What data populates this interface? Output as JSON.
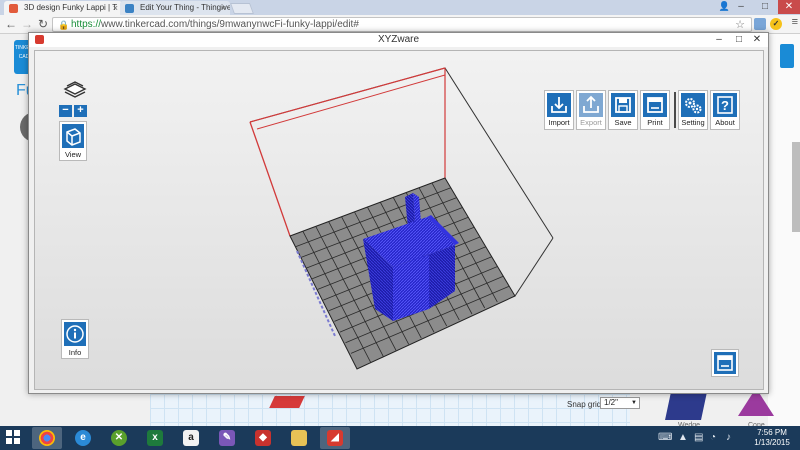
{
  "browser": {
    "tabs": [
      {
        "title": "3D design Funky Lappi | T",
        "active": true,
        "favicon_color": "#e25b3b"
      },
      {
        "title": "Edit Your Thing - Thingive",
        "active": false,
        "favicon_color": "#3b82c4"
      }
    ],
    "url_scheme": "https://",
    "url_rest": "www.tinkercad.com/things/9mwanynwcFi-funky-lappi/edit#"
  },
  "tinkercad": {
    "logo_letters": "TINKERCAD",
    "title": "Fu",
    "snap_grid_label": "Snap grid",
    "snap_grid_value": "1/2\"",
    "shape_labels": [
      "Wedge",
      "Cone"
    ]
  },
  "xyzware": {
    "window_title": "XYZware",
    "left_tools": {
      "view_label": "View",
      "info_label": "Info"
    },
    "toolbar": [
      {
        "id": "import",
        "label": "Import",
        "enabled": true
      },
      {
        "id": "export",
        "label": "Export",
        "enabled": false
      },
      {
        "id": "save",
        "label": "Save",
        "enabled": true
      },
      {
        "id": "print",
        "label": "Print",
        "enabled": true
      },
      {
        "id": "setting",
        "label": "Setting",
        "enabled": true
      },
      {
        "id": "about",
        "label": "About",
        "enabled": true
      }
    ]
  },
  "taskbar": {
    "time": "7:56 PM",
    "date": "1/13/2015"
  },
  "colors": {
    "accent_blue": "#1f6fb8",
    "model_blue": "#2b2bd6",
    "build_box_red": "#d23a3a",
    "taskbar": "#1b3a5a"
  }
}
